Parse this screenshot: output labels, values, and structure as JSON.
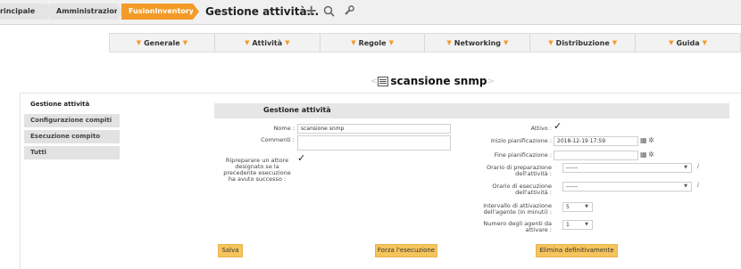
{
  "breadcrumb": [
    "rincipale",
    "Amministrazione",
    "FusionInventory"
  ],
  "page_heading": "Gestione attività...",
  "toolbar": {
    "add_icon": "plus-icon",
    "search_icon": "search-icon",
    "settings_icon": "wrench-icon"
  },
  "colors": {
    "accent": "#f39a28",
    "button": "#f6c45c"
  },
  "menu": [
    {
      "label": "Generale"
    },
    {
      "label": "Attività"
    },
    {
      "label": "Regole"
    },
    {
      "label": "Networking"
    },
    {
      "label": "Distribuzione"
    },
    {
      "label": "Guida"
    }
  ],
  "task_title": "scansione snmp",
  "leftnav": [
    {
      "label": "Gestione attività"
    },
    {
      "label": "Configurazione compiti"
    },
    {
      "label": "Esecuzione compito"
    },
    {
      "label": "Tutti"
    }
  ],
  "form": {
    "header": "Gestione attività",
    "name_label": "Nome :",
    "name_value": "scansione snmp",
    "comments_label": "Commenti :",
    "reprepare_label": [
      "Ripreparare un attore",
      "designato se la",
      "precedente esecuzione",
      "ha avuto successo :"
    ],
    "active_label": "Attivo :",
    "start_label": "Inizio pianificazione :",
    "start_value": "2018-12-19 17:59",
    "end_label": "Fine pianificazione :",
    "prep_time_label": [
      "Orario di preparazione",
      "dell'attività :"
    ],
    "prep_time_value": "------",
    "exec_time_label": [
      "Orario di esecuzione",
      "dell'attività :"
    ],
    "exec_time_value": "------",
    "interval_label": [
      "Intervallo di attivazione",
      "dell'agente (in minuti) :"
    ],
    "interval_value": "5",
    "agents_label": [
      "Numero degli agenti da",
      "attivare :"
    ],
    "agents_value": "1"
  },
  "buttons": {
    "save": "Salva",
    "force": "Forza l'esecuzione",
    "delete": "Elimina definitivamente"
  }
}
